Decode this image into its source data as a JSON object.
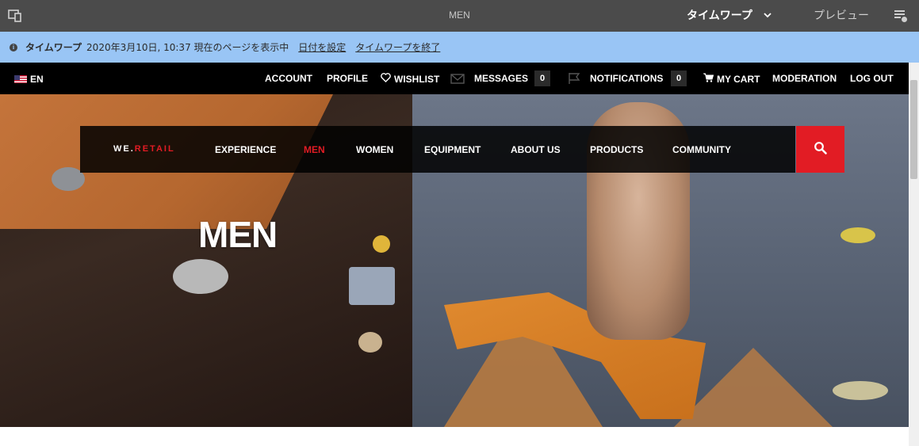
{
  "editor": {
    "page_title": "MEN",
    "timewarp_label": "タイムワープ",
    "preview_label": "プレビュー",
    "left_icon": "device-emulator-icon",
    "right_icon": "page-info-icon"
  },
  "timewarp_bar": {
    "label": "タイムワープ",
    "text": "2020年3月10日, 10:37 現在のページを表示中",
    "set_date_link": "日付を設定",
    "exit_link": "タイムワープを終了"
  },
  "top_nav": {
    "language": "EN",
    "account": "ACCOUNT",
    "profile": "PROFILE",
    "wishlist": "WISHLIST",
    "messages": "MESSAGES",
    "messages_count": "0",
    "notifications": "NOTIFICATIONS",
    "notifications_count": "0",
    "cart": "MY CART",
    "moderation": "MODERATION",
    "logout": "LOG OUT"
  },
  "main_nav": {
    "logo_prefix": "WE.",
    "logo_suffix": "RETAIL",
    "items": [
      "EXPERIENCE",
      "MEN",
      "WOMEN",
      "EQUIPMENT",
      "ABOUT US",
      "PRODUCTS",
      "COMMUNITY"
    ],
    "active": "MEN",
    "accent": "#e21c24"
  },
  "hero": {
    "title": "MEN"
  }
}
